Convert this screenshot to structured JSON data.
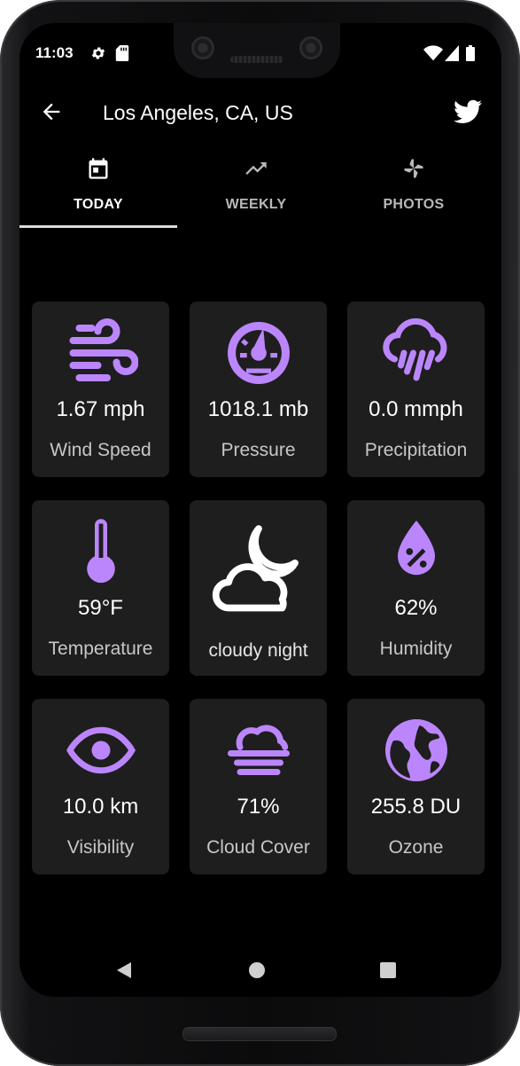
{
  "status": {
    "time": "11:03",
    "icons": [
      "gear-icon",
      "sd-card-icon",
      "wifi-icon",
      "signal-icon",
      "battery-icon"
    ]
  },
  "appbar": {
    "title": "Los Angeles, CA, US",
    "back_icon": "arrow-back-icon",
    "action_icon": "twitter-icon"
  },
  "tabs": [
    {
      "label": "TODAY",
      "icon": "calendar-icon",
      "active": true
    },
    {
      "label": "WEEKLY",
      "icon": "trending-up-icon",
      "active": false
    },
    {
      "label": "PHOTOS",
      "icon": "pinwheel-icon",
      "active": false
    }
  ],
  "accent": "#bb86fc",
  "cards": [
    {
      "value": "1.67 mph",
      "label": "Wind Speed",
      "icon": "wind-icon"
    },
    {
      "value": "1018.1 mb",
      "label": "Pressure",
      "icon": "gauge-icon"
    },
    {
      "value": "0.0 mmph",
      "label": "Precipitation",
      "icon": "rain-cloud-icon"
    },
    {
      "value": "59°F",
      "label": "Temperature",
      "icon": "thermometer-icon"
    },
    {
      "value": "",
      "label": "cloudy night",
      "icon": "cloudy-night-icon"
    },
    {
      "value": "62%",
      "label": "Humidity",
      "icon": "humidity-drop-icon"
    },
    {
      "value": "10.0 km",
      "label": "Visibility",
      "icon": "eye-icon"
    },
    {
      "value": "71%",
      "label": "Cloud Cover",
      "icon": "fog-cloud-icon"
    },
    {
      "value": "255.8 DU",
      "label": "Ozone",
      "icon": "globe-icon"
    }
  ],
  "navbar": {
    "icons": [
      "back-triangle-icon",
      "home-circle-icon",
      "recents-square-icon"
    ]
  }
}
